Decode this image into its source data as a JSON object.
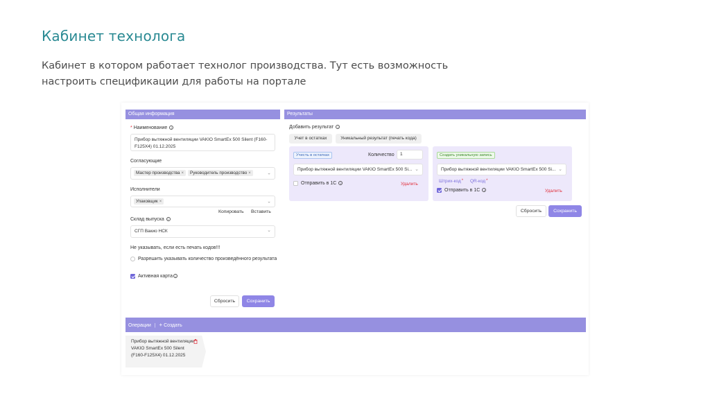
{
  "slide": {
    "title": "Кабинет технолога",
    "description": "Кабинет в котором работает технолог производства. Тут есть возможность настроить спецификации для работы на портале"
  },
  "general": {
    "header": "Общая информация",
    "name_label": "Наименование",
    "name_value": "Прибор вытяжной вентиляции VAKIO SmartEx 500 Silent (F160-F125X4) 01.12.2025",
    "approvers_label": "Согласующие",
    "approvers": [
      "Мастер производства",
      "Руководитель производство"
    ],
    "executors_label": "Исполнители",
    "executors": [
      "Упаковщик"
    ],
    "copy_label": "Копировать",
    "paste_label": "Вставить",
    "warehouse_label": "Склад выпуска",
    "warehouse_value": "СГП Вакио НСК",
    "no_print_note": "Не указывать, если есть печать кодов!!!",
    "allow_qty_label": "Разрешить указывать количество произведённого результата",
    "active_card_label": "Активная карта",
    "reset_label": "Сбросить",
    "save_label": "Сохранить"
  },
  "results": {
    "header": "Результаты",
    "add_label": "Добавить результат",
    "tabs": [
      "Учет в остатках",
      "Уникальный результат (печать кода)"
    ],
    "card1": {
      "chip": "Учесть в остатках",
      "qty_label": "Количество",
      "qty_value": "1",
      "product": "Прибор вытяжной вентиляции VAKIO SmartEx 500 Si...",
      "send_label": "Отправить в 1С",
      "delete_label": "Удалить"
    },
    "card2": {
      "chip": "Создать уникальную запись",
      "product": "Прибор вытяжной вентиляции VAKIO SmartEx 500 Si...",
      "barcode_label": "Штрих-код",
      "qr_label": "QR-код",
      "send_label": "Отправить в 1С",
      "delete_label": "Удалить"
    },
    "reset_label": "Сбросить",
    "save_label": "Сохранить"
  },
  "operations": {
    "header": "Операции",
    "create_label": "Создать",
    "item": "Прибор вытяжной вентиляции VAKIO SmartEx 500 Silent (F160-F125X4) 01.12.2025"
  },
  "colors": {
    "accent": "#8f86e6",
    "header_bar": "#9690e0",
    "title_teal": "#2a8a93",
    "delete_red": "#e0303c"
  }
}
